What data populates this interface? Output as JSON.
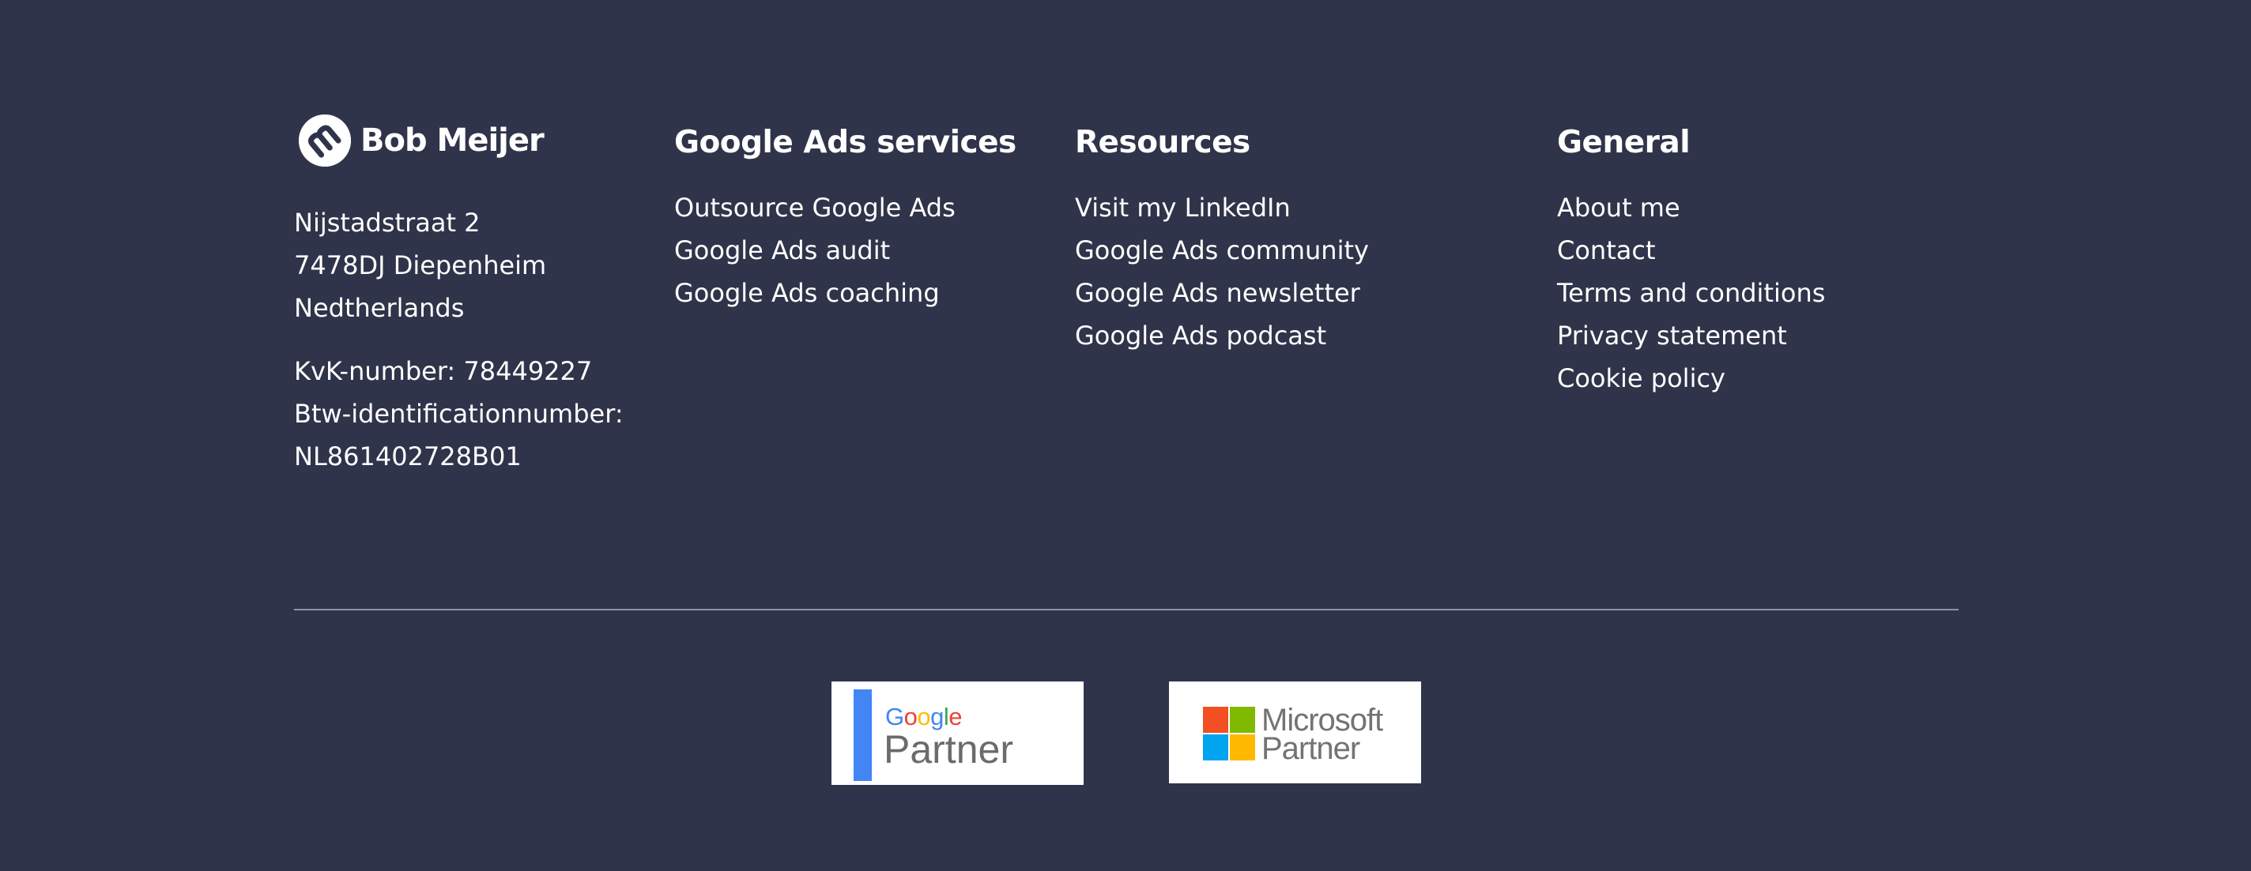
{
  "brand": {
    "name": "Bob Meijer",
    "logo_icon": "bob-meijer-b-monogram-icon"
  },
  "company": {
    "address_lines": [
      "Nijstadstraat 2",
      "7478DJ Diepenheim",
      "Nedtherlands"
    ],
    "kvk": "KvK-number: 78449227",
    "btw_label": "Btw-identificationnumber:",
    "btw_value": "NL861402728B01"
  },
  "columns": [
    {
      "heading": "Google Ads services",
      "links": [
        "Outsource Google Ads",
        "Google Ads audit",
        "Google Ads coaching"
      ]
    },
    {
      "heading": "Resources",
      "links": [
        "Visit my LinkedIn",
        "Google Ads community",
        "Google Ads newsletter",
        "Google Ads podcast"
      ]
    },
    {
      "heading": "General",
      "links": [
        "About me",
        "Contact",
        "Terms and conditions",
        "Privacy statement",
        "Cookie policy"
      ]
    }
  ],
  "badges": {
    "google": {
      "wordmark": [
        "G",
        "o",
        "o",
        "g",
        "l",
        "e"
      ],
      "wordmark_colors": [
        "#4285f4",
        "#ea4335",
        "#fbbc05",
        "#4285f4",
        "#34a853",
        "#ea4335"
      ],
      "bar_color": "#4285f4",
      "label": "Partner"
    },
    "microsoft": {
      "line1": "Microsoft",
      "line2": "Partner",
      "square_colors": [
        "#f25022",
        "#7fba00",
        "#00a4ef",
        "#ffb900"
      ]
    }
  },
  "colors": {
    "background": "#30344a",
    "text": "#ffffff",
    "divider": "#8f93a3"
  }
}
